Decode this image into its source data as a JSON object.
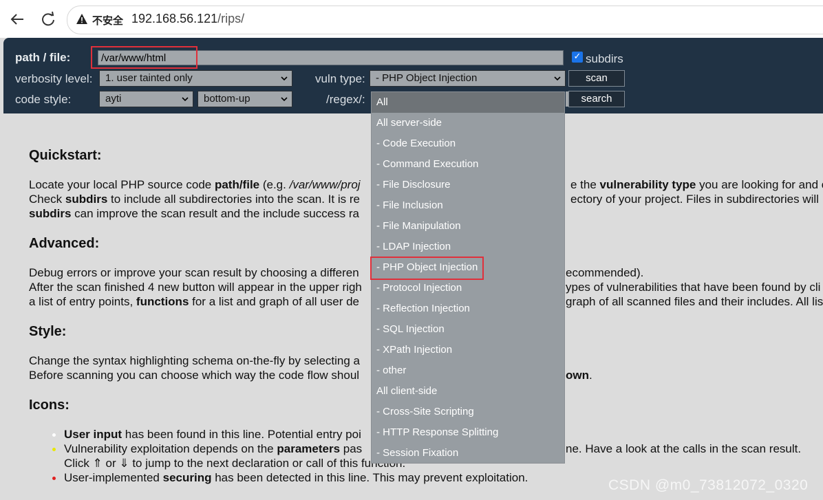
{
  "browser": {
    "insecure_label": "不安全",
    "url_host": "192.168.56.121",
    "url_path": "/rips/"
  },
  "form": {
    "path_label": "path / file:",
    "path_value": "/var/www/html",
    "subdirs_label": "subdirs",
    "verbosity_label": "verbosity level:",
    "verbosity_value": "1. user tainted only",
    "vuln_type_label": "vuln type:",
    "vuln_type_value": "- PHP Object Injection",
    "scan_label": "scan",
    "code_style_label": "code style:",
    "code_style_value": "ayti",
    "flow_value": "bottom-up",
    "regex_label": "/regex/:",
    "search_label": "search"
  },
  "dropdown": {
    "items": [
      "All",
      "All server-side",
      "- Code Execution",
      "- Command Execution",
      "- File Disclosure",
      "- File Inclusion",
      "- File Manipulation",
      "- LDAP Injection",
      "- PHP Object Injection",
      "- Protocol Injection",
      "- Reflection Injection",
      "- SQL Injection",
      "- XPath Injection",
      "- other",
      "All client-side",
      "- Cross-Site Scripting",
      "- HTTP Response Splitting",
      "- Session Fixation"
    ]
  },
  "content": {
    "quickstart_title": "Quickstart:",
    "qs_line1_a": "Locate your local PHP source code ",
    "qs_line1_b": "path/file",
    "qs_line1_c": " (e.g. ",
    "qs_line1_d": "/var/www/proj",
    "qs_line1_e": "e the ",
    "qs_line1_f": "vulnerability type",
    "qs_line1_g": " you are looking for and c",
    "qs_line2_a": "Check ",
    "qs_line2_b": "subdirs",
    "qs_line2_c": " to include all subdirectories into the scan. It is re",
    "qs_line2_d": "ectory of your project. Files in subdirectories will",
    "qs_line3_a": "subdirs",
    "qs_line3_b": " can improve the scan result and the include success ra",
    "advanced_title": "Advanced:",
    "adv_line1_a": "Debug errors or improve your scan result by choosing a differen",
    "adv_line1_b": "ecommended).",
    "adv_line2_a": "After the scan finished 4 new button will appear in the upper righ",
    "adv_line2_b": "ypes of vulnerabilities that have been found by cli",
    "adv_line3_a": "a list of entry points, ",
    "adv_line3_b": "functions",
    "adv_line3_c": " for a list and graph of all user de",
    "adv_line3_d": "graph of all scanned files and their includes. All lis",
    "style_title": "Style:",
    "style_line1": "Change the syntax highlighting schema on-the-fly by selecting a",
    "style_line2": "Before scanning you can choose which way the code flow shoul",
    "style_line2_b": "own",
    "style_line2_c": ".",
    "icons_title": "Icons:",
    "icon1_a": "User input",
    "icon1_b": " has been found in this line. Potential entry poi",
    "icon2_a": "Vulnerability exploitation depends on the ",
    "icon2_b": "parameters",
    "icon2_c": " pas",
    "icon2_d": "ne. Have a look at the calls in the scan result.",
    "icon2_line2": "Click ⇑ or ⇓ to jump to the next declaration or call of this function.",
    "icon3_a": "User-implemented ",
    "icon3_b": "securing",
    "icon3_c": " has been detected in this line. This may prevent exploitation."
  },
  "watermark": "CSDN @m0_73812072_0320"
}
